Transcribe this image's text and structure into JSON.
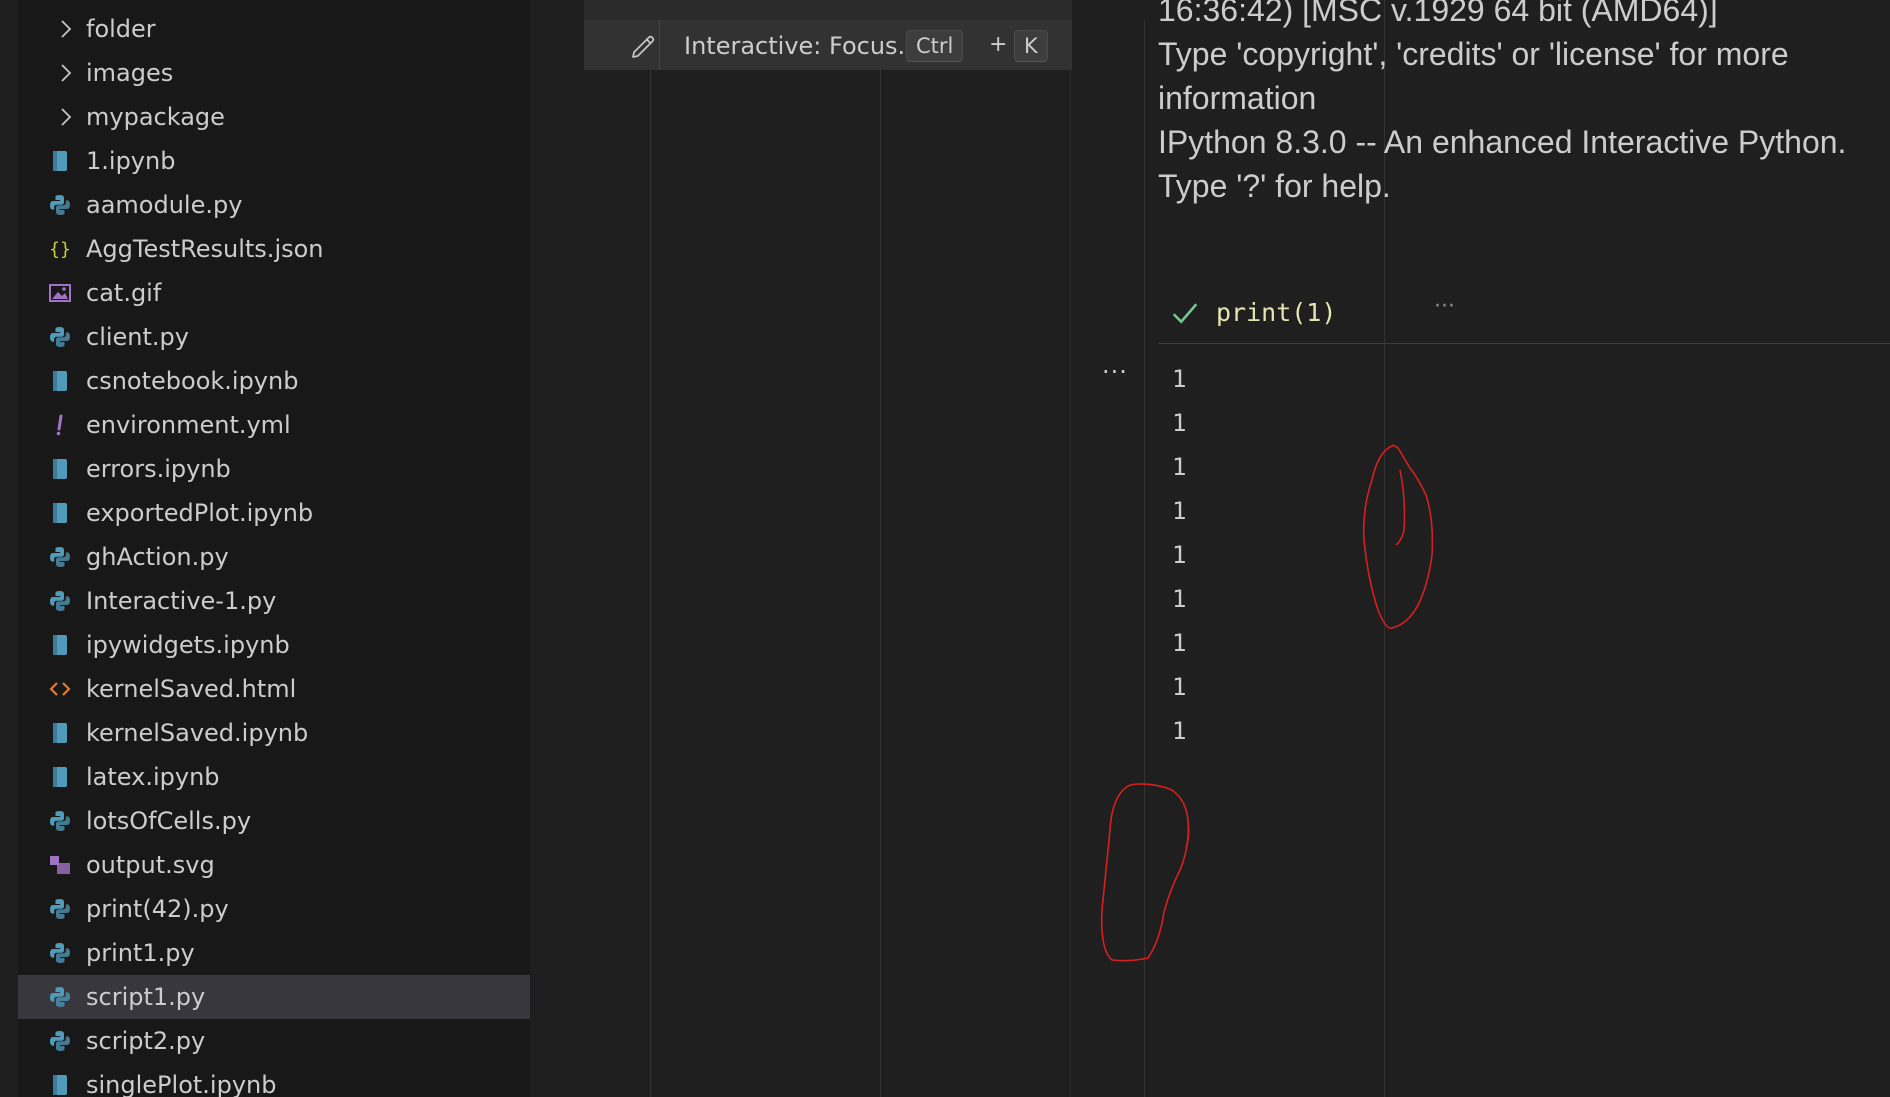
{
  "explorer": {
    "items": [
      {
        "label": "folder",
        "kind": "folder",
        "icon": "chevron-right-icon"
      },
      {
        "label": "images",
        "kind": "folder",
        "icon": "chevron-right-icon"
      },
      {
        "label": "mypackage",
        "kind": "folder",
        "icon": "chevron-right-icon"
      },
      {
        "label": "1.ipynb",
        "kind": "notebook",
        "icon": "notebook-icon"
      },
      {
        "label": "aamodule.py",
        "kind": "python",
        "icon": "python-icon"
      },
      {
        "label": "AggTestResults.json",
        "kind": "json",
        "icon": "json-braces-icon"
      },
      {
        "label": "cat.gif",
        "kind": "image",
        "icon": "image-icon"
      },
      {
        "label": "client.py",
        "kind": "python",
        "icon": "python-icon"
      },
      {
        "label": "csnotebook.ipynb",
        "kind": "notebook",
        "icon": "notebook-icon"
      },
      {
        "label": "environment.yml",
        "kind": "yaml",
        "icon": "exclamation-icon"
      },
      {
        "label": "errors.ipynb",
        "kind": "notebook",
        "icon": "notebook-icon"
      },
      {
        "label": "exportedPlot.ipynb",
        "kind": "notebook",
        "icon": "notebook-icon"
      },
      {
        "label": "ghAction.py",
        "kind": "python",
        "icon": "python-icon"
      },
      {
        "label": "Interactive-1.py",
        "kind": "python",
        "icon": "python-icon"
      },
      {
        "label": "ipywidgets.ipynb",
        "kind": "notebook",
        "icon": "notebook-icon"
      },
      {
        "label": "kernelSaved.html",
        "kind": "html",
        "icon": "html-brackets-icon"
      },
      {
        "label": "kernelSaved.ipynb",
        "kind": "notebook",
        "icon": "notebook-icon"
      },
      {
        "label": "latex.ipynb",
        "kind": "notebook",
        "icon": "notebook-icon"
      },
      {
        "label": "lotsOfCells.py",
        "kind": "python",
        "icon": "python-icon"
      },
      {
        "label": "output.svg",
        "kind": "svg",
        "icon": "svg-icon"
      },
      {
        "label": "print(42).py",
        "kind": "python",
        "icon": "python-icon"
      },
      {
        "label": "print1.py",
        "kind": "python",
        "icon": "python-icon"
      },
      {
        "label": "script1.py",
        "kind": "python",
        "icon": "python-icon",
        "selected": true
      },
      {
        "label": "script2.py",
        "kind": "python",
        "icon": "python-icon"
      },
      {
        "label": "singlePlot.ipynb",
        "kind": "notebook",
        "icon": "notebook-icon"
      }
    ]
  },
  "command_palette": {
    "item_label": "Interactive: Focus...",
    "keybinding": [
      "Ctrl",
      "+",
      "K"
    ]
  },
  "interactive_window": {
    "banner_lines": [
      "16:36:42) [MSC v.1929 64 bit (AMD64)]",
      "Type 'copyright', 'credits' or 'license' for more",
      "information",
      "IPython 8.3.0 -- An enhanced Interactive Python.",
      "Type '?' for help."
    ],
    "cell": {
      "status": "success",
      "code": "print(1)",
      "more_label": "···",
      "gutter_menu": "···",
      "outputs": [
        "1",
        "1",
        "1",
        "1",
        "1",
        "1",
        "1",
        "1",
        "1"
      ]
    }
  },
  "colors": {
    "sidebar_bg": "#181818",
    "editor_bg": "#1f1f1f",
    "selection_bg": "#37373d",
    "python_icon": "#519aba",
    "notebook_icon": "#519aba",
    "json_icon": "#cbcb41",
    "image_icon": "#a074c4",
    "yaml_icon": "#a074c4",
    "html_icon": "#e37933",
    "success_check": "#73c991",
    "annotation_ink": "#d62020"
  }
}
